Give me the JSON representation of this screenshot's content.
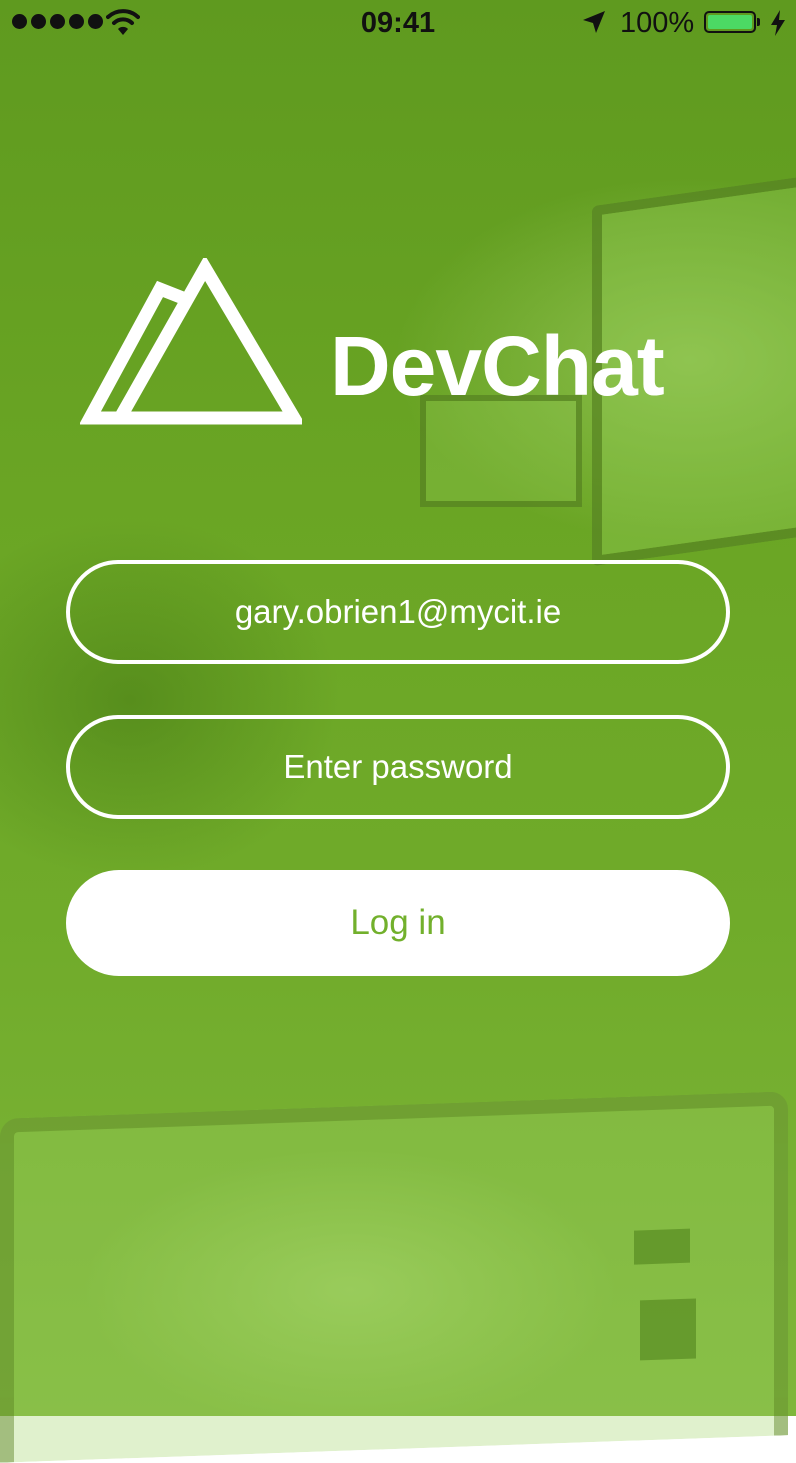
{
  "status_bar": {
    "time": "09:41",
    "battery_percent": "100%",
    "battery_level": 1.0,
    "signal_bars": 5,
    "icons": [
      "signal-dots-icon",
      "wifi-icon",
      "location-arrow-icon",
      "battery-icon",
      "charging-bolt-icon"
    ]
  },
  "app": {
    "name": "DevChat",
    "logo_icon": "mountain-logo-icon"
  },
  "login_form": {
    "email_value": "gary.obrien1@mycit.ie",
    "password_placeholder": "Enter password",
    "login_label": "Log in"
  },
  "colors": {
    "overlay_green": "#6aa524",
    "button_text": "#72b02c",
    "battery_fill": "#4cd964",
    "white": "#ffffff"
  }
}
